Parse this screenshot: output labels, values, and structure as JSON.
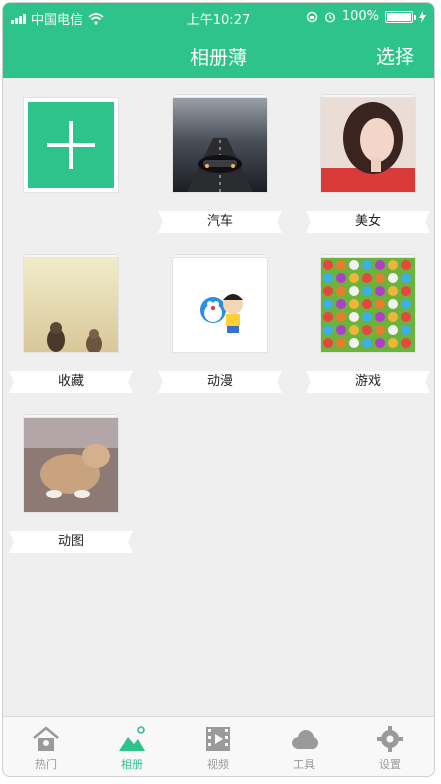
{
  "status_bar": {
    "carrier": "中国电信",
    "time": "上午10:27",
    "battery": "100%",
    "battery_level": 1.0
  },
  "nav": {
    "title": "相册薄",
    "right_action": "选择"
  },
  "albums": [
    {
      "label": "汽车",
      "thumb": "dark-road-car"
    },
    {
      "label": "美女",
      "thumb": "girl-portrait"
    },
    {
      "label": "收藏",
      "thumb": "sunset-couple"
    },
    {
      "label": "动漫",
      "thumb": "doraemon-cartoon"
    },
    {
      "label": "游戏",
      "thumb": "match3-candies"
    },
    {
      "label": "动图",
      "thumb": "puppy-gif"
    }
  ],
  "tabs": [
    {
      "label": "热门",
      "icon": "home-icon",
      "active": false
    },
    {
      "label": "相册",
      "icon": "mountain-icon",
      "active": true
    },
    {
      "label": "视频",
      "icon": "film-icon",
      "active": false
    },
    {
      "label": "工具",
      "icon": "cloud-icon",
      "active": false
    },
    {
      "label": "设置",
      "icon": "gear-icon",
      "active": false
    }
  ],
  "colors": {
    "accent": "#2ec38a",
    "background": "#efefef",
    "tab_inactive": "#9a9a9a"
  }
}
